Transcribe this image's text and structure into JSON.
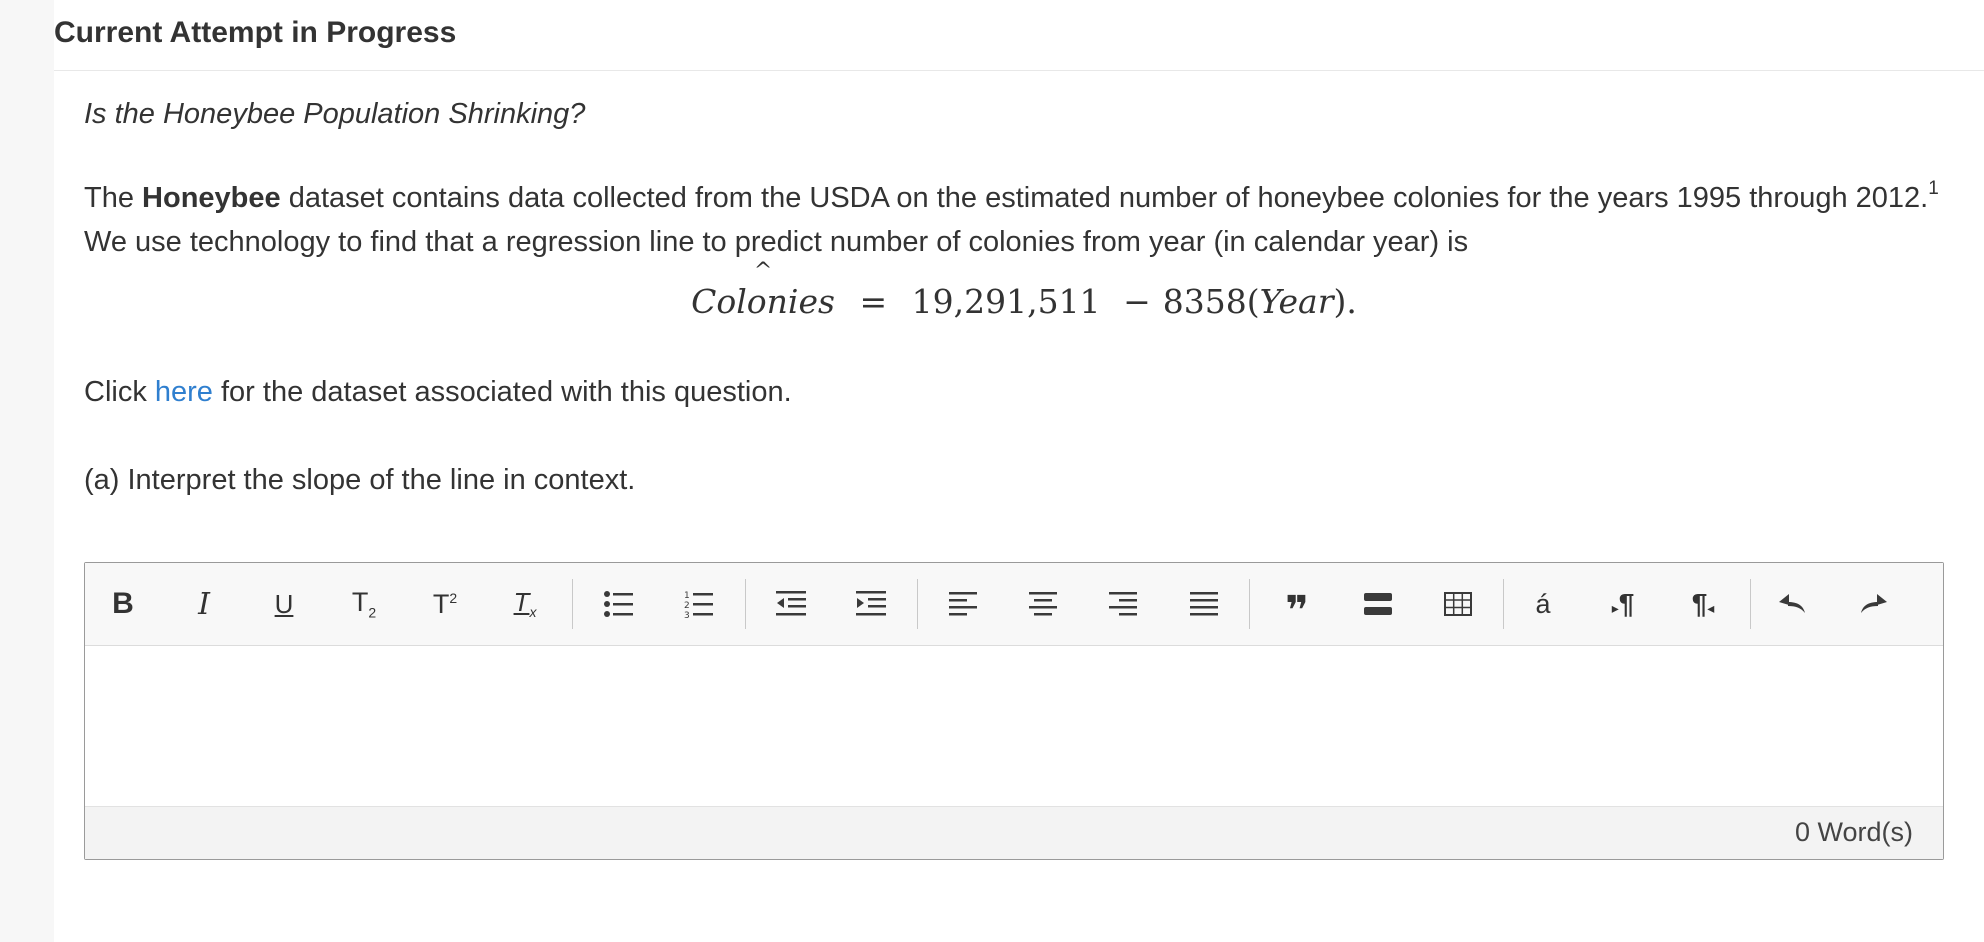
{
  "header": {
    "title": "Current Attempt in Progress"
  },
  "question": {
    "title": "Is the Honeybee Population Shrinking?",
    "intro_prefix": "The ",
    "dataset_name": "Honeybee",
    "intro_mid": " dataset contains data collected from the USDA on the estimated number of honeybee colonies for the years 1995 through 2012.",
    "footnote": "1",
    "intro_suffix": " We use technology to find that a regression line to predict number of colonies from year (in calendar year) is",
    "equation": {
      "response": "Colonies",
      "hat": "^",
      "equals": "=",
      "intercept": "19,291,511",
      "minus": "−",
      "slope": "8358",
      "open_paren": "(",
      "predictor": "Year",
      "close_paren": ")."
    },
    "click_prefix": "Click ",
    "click_link": "here",
    "click_suffix": " for the dataset associated with this question.",
    "part_a": "(a) Interpret the slope of the line in context."
  },
  "editor": {
    "toolbar": [
      {
        "name": "bold-button",
        "icon": "bold-icon"
      },
      {
        "name": "italic-button",
        "icon": "italic-icon"
      },
      {
        "name": "underline-button",
        "icon": "underline-icon"
      },
      {
        "name": "subscript-button",
        "icon": "subscript-icon"
      },
      {
        "name": "superscript-button",
        "icon": "superscript-icon"
      },
      {
        "name": "clear-formatting-button",
        "icon": "clear-formatting-icon"
      },
      {
        "name": "bulleted-list-button",
        "icon": "bulleted-list-icon"
      },
      {
        "name": "numbered-list-button",
        "icon": "numbered-list-icon"
      },
      {
        "name": "outdent-button",
        "icon": "outdent-icon"
      },
      {
        "name": "indent-button",
        "icon": "indent-icon"
      },
      {
        "name": "align-left-button",
        "icon": "align-left-icon"
      },
      {
        "name": "align-center-button",
        "icon": "align-center-icon"
      },
      {
        "name": "align-right-button",
        "icon": "align-right-icon"
      },
      {
        "name": "justify-button",
        "icon": "justify-icon"
      },
      {
        "name": "blockquote-button",
        "icon": "quote-icon"
      },
      {
        "name": "horizontal-rule-button",
        "icon": "horizontal-rule-icon"
      },
      {
        "name": "insert-table-button",
        "icon": "table-icon"
      },
      {
        "name": "special-characters-button",
        "icon": "accent-character-icon"
      },
      {
        "name": "ltr-direction-button",
        "icon": "ltr-paragraph-icon"
      },
      {
        "name": "rtl-direction-button",
        "icon": "rtl-paragraph-icon"
      },
      {
        "name": "undo-button",
        "icon": "undo-icon"
      },
      {
        "name": "redo-button",
        "icon": "redo-icon"
      }
    ],
    "special_char_label": "á",
    "word_count": "0 Word(s)"
  }
}
